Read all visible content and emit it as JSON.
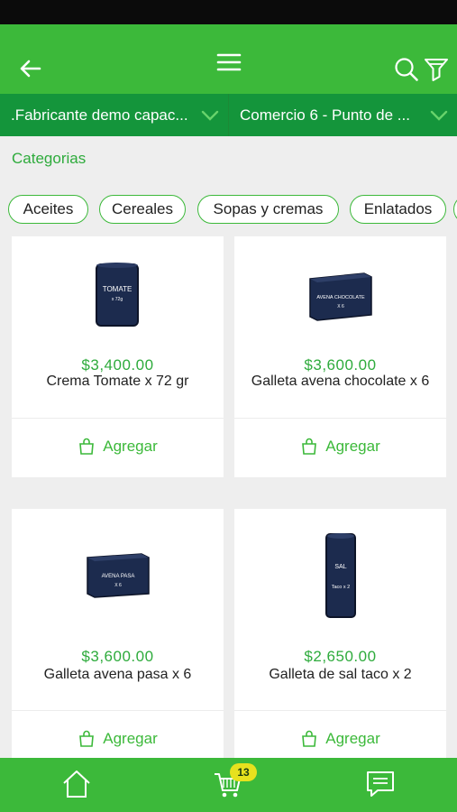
{
  "header": {
    "back_icon": "back-arrow-icon",
    "menu_icon": "hamburger-menu-icon",
    "search_icon": "search-icon",
    "filter_icon": "filter-icon"
  },
  "selectors": {
    "manufacturer": ".Fabricante demo capac...",
    "store": "Comercio 6 - Punto de ..."
  },
  "categories": {
    "title": "Categorias",
    "chips": [
      "Aceites",
      "Cereales",
      "Sopas y cremas",
      "Enlatados"
    ]
  },
  "products": [
    {
      "price": "$3,400.00",
      "name": "Crema Tomate x 72 gr",
      "add_label": "Agregar",
      "pack_text": "TOMATE",
      "pack_sub": "x 72g"
    },
    {
      "price": "$3,600.00",
      "name": "Galleta avena chocolate x 6",
      "add_label": "Agregar",
      "pack_text": "AVENA CHOCOLATE",
      "pack_sub": "X 6"
    },
    {
      "price": "$3,600.00",
      "name": "Galleta avena pasa x 6",
      "add_label": "Agregar",
      "pack_text": "AVENA PASA",
      "pack_sub": "X 6"
    },
    {
      "price": "$2,650.00",
      "name": "Galleta de sal taco x 2",
      "add_label": "Agregar",
      "pack_text": "SAL",
      "pack_sub": "Taco x 2"
    }
  ],
  "bottom_nav": {
    "cart_count": "13",
    "items": [
      "home-icon",
      "cart-icon",
      "messages-icon"
    ]
  },
  "colors": {
    "primary": "#3cb93a",
    "dark_green": "#14953b",
    "badge": "#e7e11e",
    "product_navy": "#1c2b4e"
  }
}
